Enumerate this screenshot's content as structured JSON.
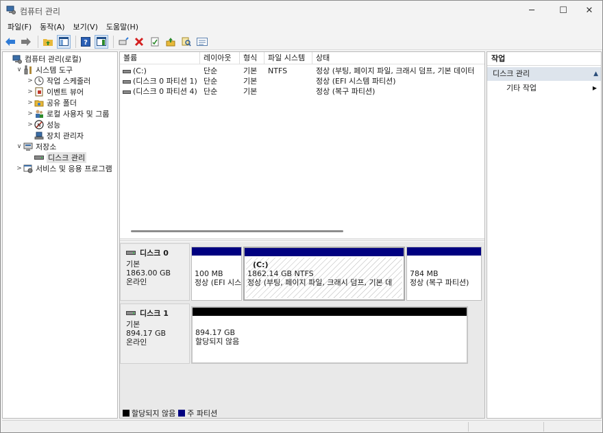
{
  "window": {
    "title": "컴퓨터 관리",
    "min_glyph": "─",
    "max_glyph": "☐",
    "close_glyph": "✕"
  },
  "menu": [
    "파일(F)",
    "동작(A)",
    "보기(V)",
    "도움말(H)"
  ],
  "toolbar": [
    "back-icon",
    "forward-icon",
    "up-folder-icon",
    "show-hide-tree-icon",
    "help-icon",
    "show-hide-action-pane-icon",
    "connect-icon",
    "delete-icon",
    "properties-icon",
    "import-icon",
    "search-icon",
    "list-icon"
  ],
  "tree": [
    {
      "label": "컴퓨터 관리(로컬)",
      "icon": "computer-management-icon",
      "expander": "",
      "level": 0
    },
    {
      "label": "시스템 도구",
      "icon": "system-tools-icon",
      "expander": "∨",
      "level": 1
    },
    {
      "label": "작업 스케줄러",
      "icon": "task-scheduler-icon",
      "expander": ">",
      "level": 2
    },
    {
      "label": "이벤트 뷰어",
      "icon": "event-viewer-icon",
      "expander": ">",
      "level": 2
    },
    {
      "label": "공유 폴더",
      "icon": "shared-folders-icon",
      "expander": ">",
      "level": 2
    },
    {
      "label": "로컬 사용자 및 그룹",
      "icon": "local-users-icon",
      "expander": ">",
      "level": 2
    },
    {
      "label": "성능",
      "icon": "performance-icon",
      "expander": ">",
      "level": 2
    },
    {
      "label": "장치 관리자",
      "icon": "device-manager-icon",
      "expander": "",
      "level": 2
    },
    {
      "label": "저장소",
      "icon": "storage-icon",
      "expander": "∨",
      "level": 1
    },
    {
      "label": "디스크 관리",
      "icon": "disk-management-icon",
      "expander": "",
      "level": 2,
      "selected": true
    },
    {
      "label": "서비스 및 응용 프로그램",
      "icon": "services-icon",
      "expander": ">",
      "level": 1
    }
  ],
  "volumes": {
    "columns": [
      "볼륨",
      "레이아웃",
      "형식",
      "파일 시스템",
      "상태"
    ],
    "rows": [
      {
        "volume": "(C:)",
        "layout": "단순",
        "type": "기본",
        "fs": "NTFS",
        "status": "정상 (부팅, 페이지 파일, 크래시 덤프, 기본 데이터"
      },
      {
        "volume": "(디스크 0 파티션 1)",
        "layout": "단순",
        "type": "기본",
        "fs": "",
        "status": "정상 (EFI 시스템 파티션)"
      },
      {
        "volume": "(디스크 0 파티션 4)",
        "layout": "단순",
        "type": "기본",
        "fs": "",
        "status": "정상 (복구 파티션)"
      }
    ]
  },
  "disks": [
    {
      "name": "디스크 0",
      "kind": "기본",
      "size": "1863.00 GB",
      "state": "온라인",
      "partitions": [
        {
          "title": "",
          "size": "100 MB",
          "status": "정상 (EFI 시스"
        },
        {
          "title": "(C:)",
          "size": "1862.14 GB NTFS",
          "status": "정상 (부팅, 페이지 파일, 크래시 덤프, 기본 데"
        },
        {
          "title": "",
          "size": "784 MB",
          "status": "정상 (복구 파티션)"
        }
      ]
    },
    {
      "name": "디스크 1",
      "kind": "기본",
      "size": "894.17 GB",
      "state": "온라인",
      "partitions": [
        {
          "title": "",
          "size": "894.17 GB",
          "status": "할당되지 않음"
        }
      ]
    }
  ],
  "legend": [
    {
      "label": "할당되지 않음",
      "color": "#000000"
    },
    {
      "label": "주 파티션",
      "color": "#000080"
    }
  ],
  "actions": {
    "header": "작업",
    "section": "디스크 관리",
    "section_arrow": "▲",
    "item": "기타 작업",
    "item_arrow": "▶"
  },
  "colors": {
    "primary_partition": "#000080",
    "unallocated": "#000000",
    "accent": "#0078d4"
  }
}
